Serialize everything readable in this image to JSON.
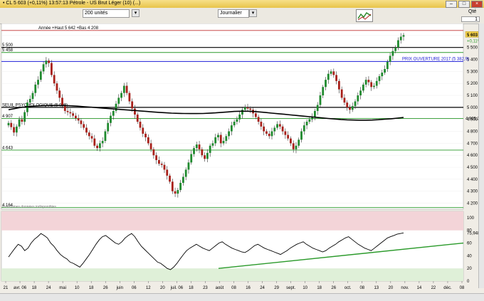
{
  "window": {
    "title": "• CL   5 603 (+0,11%)   13:57:13 Pétrole - US Brut Léger (10) (...)",
    "min": "–",
    "max": "□",
    "close": "×"
  },
  "toolbar": {
    "units": "200 unités",
    "period": "Journalier",
    "qty_label": "Qté",
    "qty_value": "1"
  },
  "colors": {
    "up": "#1f8a2e",
    "down": "#a8201a",
    "blue_line": "#1e1ed7",
    "red_line": "#c03030",
    "green_line": "#2a9a2a"
  },
  "chart_data": [
    {
      "type": "candlestick",
      "info": "Année +Haut 5 642 +Bas 4 208",
      "ylim": [
        4150,
        5700
      ],
      "ticks": [
        5600,
        5500,
        5400,
        5300,
        5200,
        5100,
        5000,
        4900,
        4800,
        4700,
        4600,
        4500,
        4400,
        4300,
        4200
      ],
      "tick_labels": [
        "5 600",
        "5 500",
        "5 400",
        "5 300",
        "5 200",
        "5 100",
        "5 000",
        "4 900",
        "4 800",
        "4 700",
        "4 600",
        "4 500",
        "4 400",
        "4 300",
        "4 200"
      ],
      "last_price": {
        "value": 5603,
        "label": "5 603",
        "change": "+0,11%"
      },
      "levels": [
        {
          "value": 5642,
          "label": "",
          "color": "red"
        },
        {
          "value": 5500,
          "label": "5 500",
          "color": "black"
        },
        {
          "value": 5458,
          "label": "5 458",
          "color": "green"
        },
        {
          "value": 5383,
          "label": "PRIX OUVERTURE 2017 (5 382,9)",
          "color": "blue"
        },
        {
          "value": 5000,
          "label": "SEUIL PSYCHOLOGIQUE (5 000)",
          "color": "black"
        },
        {
          "value": 4907,
          "label": "4 907",
          "color": "green"
        },
        {
          "value": 4643,
          "label": "4 643",
          "color": "green"
        },
        {
          "value": 4164,
          "label": "4 164",
          "color": "green"
        }
      ],
      "ma_label": "4 905,3",
      "note": "Prochaines données indisponibles",
      "closes": [
        4870,
        4835,
        4790,
        4840,
        4900,
        4880,
        4960,
        5040,
        5070,
        5120,
        5190,
        5230,
        5300,
        5360,
        5390,
        5370,
        5270,
        5200,
        5140,
        5080,
        5010,
        4970,
        4960,
        4950,
        4930,
        4910,
        4890,
        4860,
        4830,
        4790,
        4760,
        4740,
        4680,
        4660,
        4700,
        4720,
        4800,
        4870,
        4930,
        4970,
        5030,
        5080,
        5120,
        5180,
        5120,
        5050,
        4990,
        4940,
        4880,
        4830,
        4780,
        4750,
        4700,
        4650,
        4600,
        4560,
        4530,
        4520,
        4480,
        4430,
        4380,
        4300,
        4280,
        4310,
        4370,
        4420,
        4480,
        4540,
        4610,
        4660,
        4690,
        4650,
        4600,
        4570,
        4620,
        4680,
        4700,
        4750,
        4770,
        4700,
        4720,
        4760,
        4800,
        4850,
        4880,
        4900,
        4940,
        4980,
        5000,
        4990,
        4980,
        4950,
        4920,
        4880,
        4840,
        4800,
        4780,
        4760,
        4800,
        4830,
        4860,
        4840,
        4800,
        4770,
        4740,
        4700,
        4650,
        4680,
        4730,
        4800,
        4850,
        4880,
        4900,
        4920,
        4970,
        5020,
        5100,
        5170,
        5230,
        5280,
        5300,
        5270,
        5220,
        5150,
        5080,
        5040,
        5000,
        4980,
        5010,
        5050,
        5100,
        5140,
        5190,
        5230,
        5210,
        5170,
        5180,
        5220,
        5260,
        5290,
        5320,
        5380,
        5430,
        5470,
        5500,
        5560,
        5590,
        5603
      ],
      "ma": [
        4980,
        4990,
        5000,
        5005,
        5010,
        5013,
        5015,
        5016,
        5016,
        5015,
        5013,
        5010,
        5006,
        5002,
        4998,
        4994,
        4990,
        4986,
        4982,
        4978,
        4974,
        4970,
        4966,
        4962,
        4958,
        4955,
        4952,
        4950,
        4949,
        4948,
        4948,
        4949,
        4951,
        4954,
        4958,
        4962,
        4966,
        4968,
        4968,
        4966,
        4962,
        4957,
        4952,
        4947,
        4942,
        4937,
        4932,
        4927,
        4922,
        4917,
        4912,
        4907,
        4903,
        4899,
        4896,
        4894,
        4893,
        4893,
        4894,
        4897,
        4901,
        4905,
        4910,
        4916
      ],
      "ma_start": 0
    },
    {
      "type": "line",
      "ylim": [
        0,
        110
      ],
      "ticks": [
        100,
        80,
        60,
        40,
        20,
        0
      ],
      "tick_labels": [
        "100",
        "80",
        "60",
        "40",
        "20",
        "0"
      ],
      "last": "75,948",
      "values": [
        38,
        45,
        52,
        58,
        55,
        48,
        52,
        60,
        66,
        70,
        75,
        72,
        68,
        60,
        55,
        48,
        42,
        38,
        35,
        30,
        28,
        25,
        22,
        28,
        35,
        42,
        50,
        58,
        65,
        70,
        72,
        68,
        64,
        60,
        58,
        62,
        68,
        72,
        75,
        70,
        62,
        55,
        50,
        45,
        40,
        35,
        30,
        28,
        24,
        20,
        18,
        22,
        28,
        35,
        42,
        48,
        52,
        55,
        58,
        55,
        52,
        50,
        48,
        52,
        56,
        60,
        62,
        58,
        55,
        52,
        50,
        48,
        46,
        45,
        48,
        52,
        56,
        58,
        55,
        52,
        50,
        48,
        46,
        44,
        42,
        45,
        48,
        52,
        55,
        58,
        60,
        62,
        58,
        55,
        52,
        50,
        48,
        46,
        48,
        52,
        55,
        58,
        62,
        65,
        68,
        70,
        66,
        62,
        58,
        55,
        52,
        50,
        48,
        52,
        56,
        60,
        64,
        68,
        70,
        72,
        74,
        75,
        76
      ],
      "trend": [
        [
          0.47,
          20
        ],
        [
          1.0,
          60
        ]
      ]
    }
  ],
  "x_axis": {
    "labels": [
      "21",
      "avr. 06",
      "18",
      "24",
      "mai",
      "10",
      "18",
      "26",
      "juin",
      "06",
      "12",
      "20",
      "juil. 06",
      "18",
      "23",
      "août",
      "08",
      "16",
      "24",
      "29",
      "sept.",
      "10",
      "18",
      "26",
      "oct.",
      "08",
      "13",
      "20",
      "nov.",
      "14",
      "22",
      "déc.",
      "08"
    ]
  }
}
